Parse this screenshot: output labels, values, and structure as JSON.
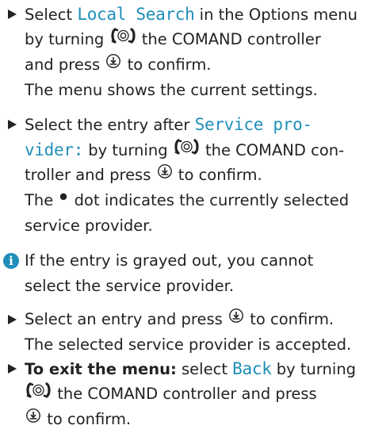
{
  "step1": {
    "l1a": "Select ",
    "l1b": "Local Search",
    "l1c": " in the Options menu",
    "l2a": "by turning ",
    "l2b": " the COMAND controller",
    "l3a": "and press ",
    "l3b": " to confirm.",
    "l4": "The menu shows the current settings."
  },
  "step2": {
    "l1a": "Select the entry after ",
    "l1b": "Service pro-",
    "l2a": "vider:",
    "l2b": " by turning ",
    "l2c": " the COMAND con-",
    "l3a": "troller and press ",
    "l3b": " to confirm.",
    "l4a": "The ",
    "l4b": " dot indicates the currently selected",
    "l5": "service provider."
  },
  "info": {
    "icon_glyph": "i",
    "l1": "If the entry is grayed out, you cannot",
    "l2": "select the service provider."
  },
  "step3": {
    "l1a": "Select an entry and press ",
    "l1b": " to confirm.",
    "l2": "The selected service provider is accepted."
  },
  "step4": {
    "l1a": "To exit the menu:",
    "l1b": " select ",
    "l1c": "Back",
    "l1d": " by turning",
    "l2a": " the COMAND controller and press",
    "l3a": " to confirm."
  },
  "colors": {
    "text": "#222222",
    "accent": "#1f8fb9"
  },
  "icons": {
    "bullet": "triangle-bullet-icon",
    "controller": "controller-turn-icon",
    "press": "controller-press-icon",
    "dot": "selection-dot-icon",
    "info": "info-icon"
  }
}
